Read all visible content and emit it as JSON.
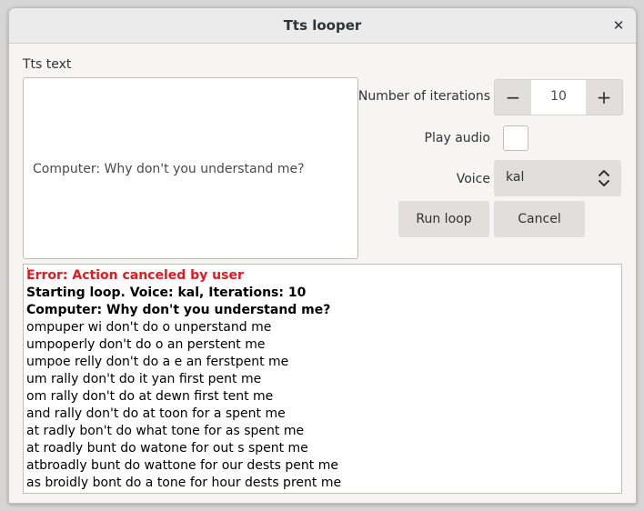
{
  "window": {
    "title": "Tts looper"
  },
  "tts": {
    "label": "Tts text",
    "text": "Computer: Why don't you understand me?"
  },
  "iterations": {
    "label": "Number of iterations",
    "value": "10",
    "minus": "−",
    "plus": "+"
  },
  "play_audio": {
    "label": "Play audio",
    "checked": false
  },
  "voice": {
    "label": "Voice",
    "selected": "kal"
  },
  "buttons": {
    "run": "Run loop",
    "cancel": "Cancel"
  },
  "log": {
    "marker": ".",
    "error": "Error: Action canceled by user",
    "header1": "Starting loop. Voice: kal, Iterations: 10",
    "header2": "Computer: Why don't you understand me?",
    "lines": [
      "ompuper wi don't do o unperstand me",
      "umpoperly don't do o an perstent me",
      "umpoe relly don't do a e an ferstpent me",
      "um rally don't do it yan first pent me",
      "om rally don't do at dewn first tent me",
      "and rally don't do at toon for a spent me",
      "at radly bon't do what tone for as spent me",
      "at roadly bunt do watone for out s spent me",
      "atbroadly bunt do wattone for our dests pent me",
      "as broidly bont do a tone for hour dests prent me"
    ]
  },
  "colors": {
    "error": "#e8171f",
    "window_bg": "#f6f5f4",
    "button_bg": "#e1dedb"
  }
}
